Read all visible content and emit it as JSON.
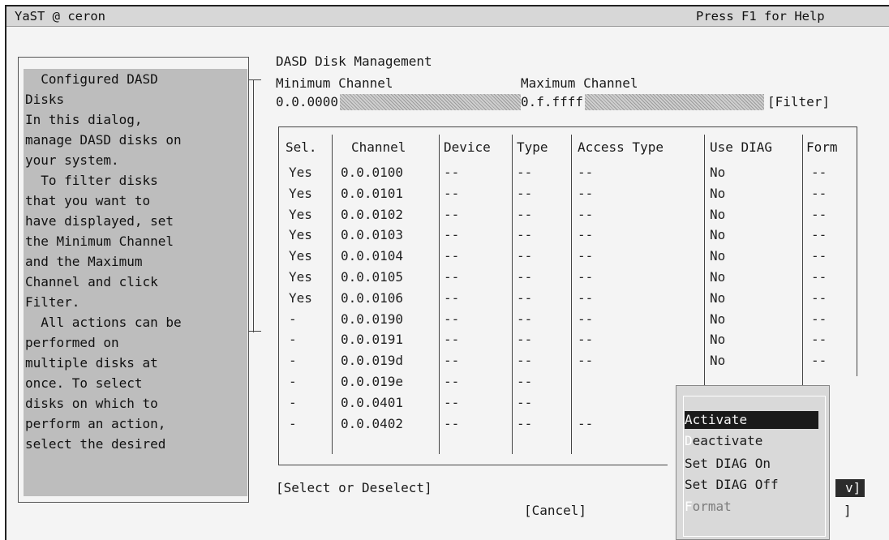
{
  "window": {
    "title": "YaST @ ceron",
    "help_hint": "Press F1 for Help"
  },
  "help": {
    "lines": [
      "  Configured DASD",
      "Disks",
      "In this dialog,",
      "manage DASD disks on",
      "your system.",
      "  To filter disks",
      "that you want to",
      "have displayed, set",
      "the Minimum Channel",
      "and the Maximum",
      "Channel and click",
      "Filter.",
      "  All actions can be",
      "performed on",
      "multiple disks at",
      "once. To select",
      "disks on which to",
      "perform an action,",
      "select the desired"
    ]
  },
  "dialog": {
    "heading": "DASD Disk Management",
    "min_label": "Minimum Channel",
    "max_label": "Maximum Channel",
    "min_value": "0.0.0000",
    "max_value": "0.f.ffff",
    "filter_button": "[Filter]"
  },
  "table": {
    "columns": [
      "Sel.",
      "Channel",
      "Device",
      "Type",
      "Access Type",
      "Use DIAG",
      "Form"
    ],
    "rows": [
      [
        "Yes",
        "0.0.0100",
        "--",
        "--",
        "--",
        "No",
        "--"
      ],
      [
        "Yes",
        "0.0.0101",
        "--",
        "--",
        "--",
        "No",
        "--"
      ],
      [
        "Yes",
        "0.0.0102",
        "--",
        "--",
        "--",
        "No",
        "--"
      ],
      [
        "Yes",
        "0.0.0103",
        "--",
        "--",
        "--",
        "No",
        "--"
      ],
      [
        "Yes",
        "0.0.0104",
        "--",
        "--",
        "--",
        "No",
        "--"
      ],
      [
        "Yes",
        "0.0.0105",
        "--",
        "--",
        "--",
        "No",
        "--"
      ],
      [
        "Yes",
        "0.0.0106",
        "--",
        "--",
        "--",
        "No",
        "--"
      ],
      [
        "-",
        "0.0.0190",
        "--",
        "--",
        "--",
        "No",
        "--"
      ],
      [
        "-",
        "0.0.0191",
        "--",
        "--",
        "--",
        "No",
        "--"
      ],
      [
        "-",
        "0.0.019d",
        "--",
        "--",
        "--",
        "No",
        "--"
      ],
      [
        "-",
        "0.0.019e",
        "--",
        "--",
        "",
        "",
        ""
      ],
      [
        "-",
        "0.0.0401",
        "--",
        "--",
        "",
        "",
        ""
      ],
      [
        "-",
        "0.0.0402",
        "--",
        "--",
        "--",
        "",
        ""
      ]
    ]
  },
  "buttons": {
    "select": "[Select or Deselect]",
    "cancel": "[Cancel]",
    "perform_tail": "v]",
    "next_tail": "]"
  },
  "menu": {
    "items": [
      {
        "hotkey": "A",
        "rest": "ctivate",
        "selected": true
      },
      {
        "hotkey": "D",
        "rest": "eactivate",
        "selected": false
      },
      {
        "hotkey": "",
        "rest": "Set DIAG On",
        "selected": false
      },
      {
        "hotkey": "",
        "rest": "Set DIAG Off",
        "selected": false
      },
      {
        "hotkey": "F",
        "rest": "ormat",
        "selected": false
      }
    ]
  }
}
